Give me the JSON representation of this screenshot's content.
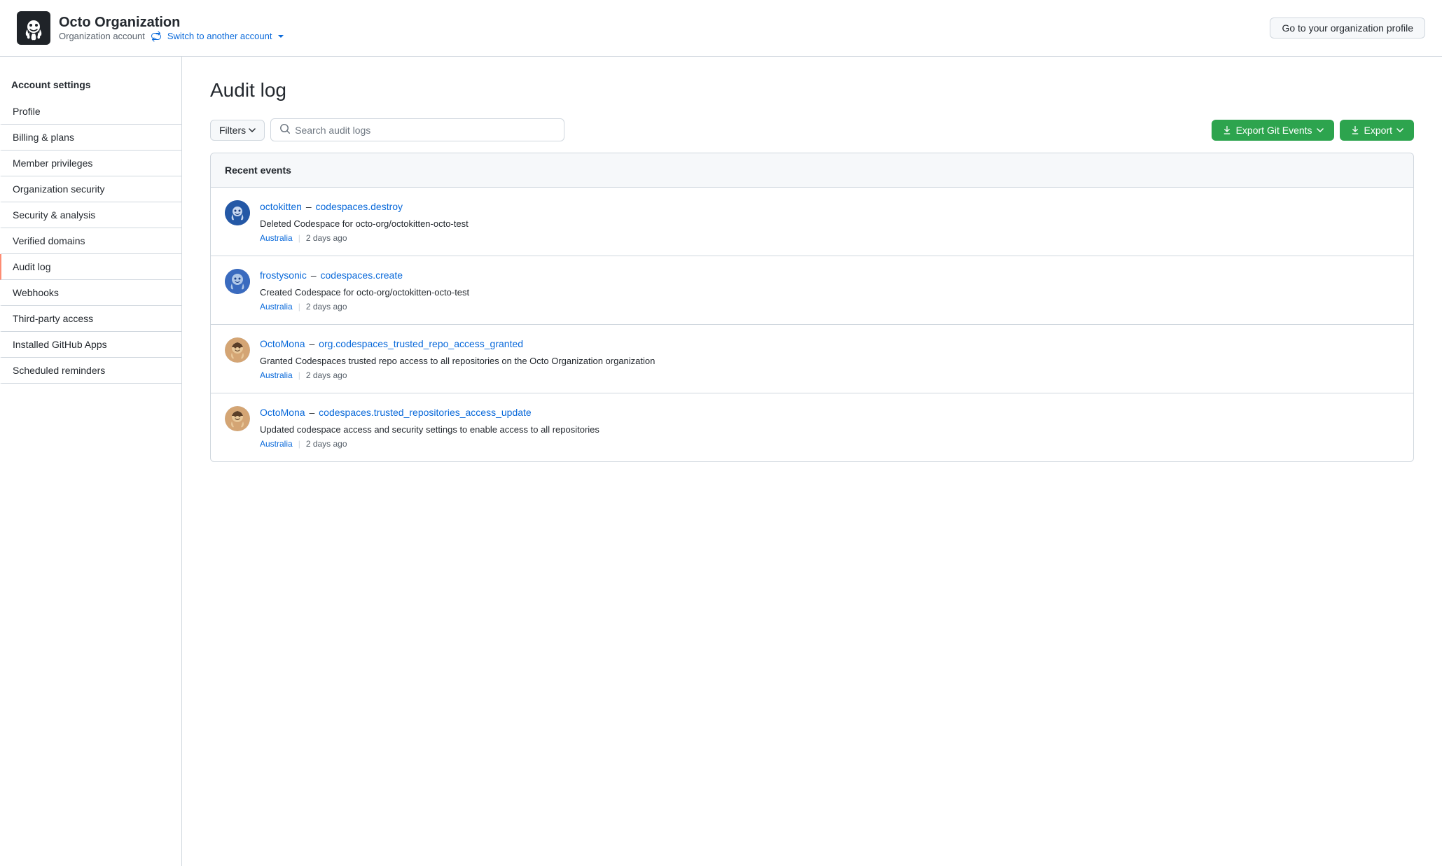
{
  "header": {
    "org_name": "Octo Organization",
    "org_type": "Organization account",
    "switch_account_label": "Switch to another account",
    "org_profile_btn": "Go to your organization profile"
  },
  "sidebar": {
    "heading": "Account settings",
    "items": [
      {
        "id": "profile",
        "label": "Profile",
        "active": false
      },
      {
        "id": "billing",
        "label": "Billing & plans",
        "active": false
      },
      {
        "id": "member-privileges",
        "label": "Member privileges",
        "active": false
      },
      {
        "id": "org-security",
        "label": "Organization security",
        "active": false
      },
      {
        "id": "security-analysis",
        "label": "Security & analysis",
        "active": false
      },
      {
        "id": "verified-domains",
        "label": "Verified domains",
        "active": false
      },
      {
        "id": "audit-log",
        "label": "Audit log",
        "active": true
      },
      {
        "id": "webhooks",
        "label": "Webhooks",
        "active": false
      },
      {
        "id": "third-party",
        "label": "Third-party access",
        "active": false
      },
      {
        "id": "github-apps",
        "label": "Installed GitHub Apps",
        "active": false
      },
      {
        "id": "scheduled-reminders",
        "label": "Scheduled reminders",
        "active": false
      }
    ]
  },
  "main": {
    "page_title": "Audit log",
    "filters_btn": "Filters",
    "search_placeholder": "Search audit logs",
    "export_git_events_btn": "Export Git Events",
    "export_btn": "Export",
    "events_section_title": "Recent events",
    "events": [
      {
        "id": "event1",
        "user": "octokitten",
        "action": "codespaces.destroy",
        "description": "Deleted Codespace for octo-org/octokitten-octo-test",
        "location": "Australia",
        "time": "2 days ago",
        "avatar_type": "blue"
      },
      {
        "id": "event2",
        "user": "frostysonic",
        "action": "codespaces.create",
        "description": "Created Codespace for octo-org/octokitten-octo-test",
        "location": "Australia",
        "time": "2 days ago",
        "avatar_type": "blue"
      },
      {
        "id": "event3",
        "user": "OctoMona",
        "action": "org.codespaces_trusted_repo_access_granted",
        "description": "Granted Codespaces trusted repo access to all repositories on the Octo Organization organization",
        "location": "Australia",
        "time": "2 days ago",
        "avatar_type": "beige"
      },
      {
        "id": "event4",
        "user": "OctoMona",
        "action": "codespaces.trusted_repositories_access_update",
        "description": "Updated codespace access and security settings to enable access to all repositories",
        "location": "Australia",
        "time": "2 days ago",
        "avatar_type": "beige"
      }
    ]
  }
}
